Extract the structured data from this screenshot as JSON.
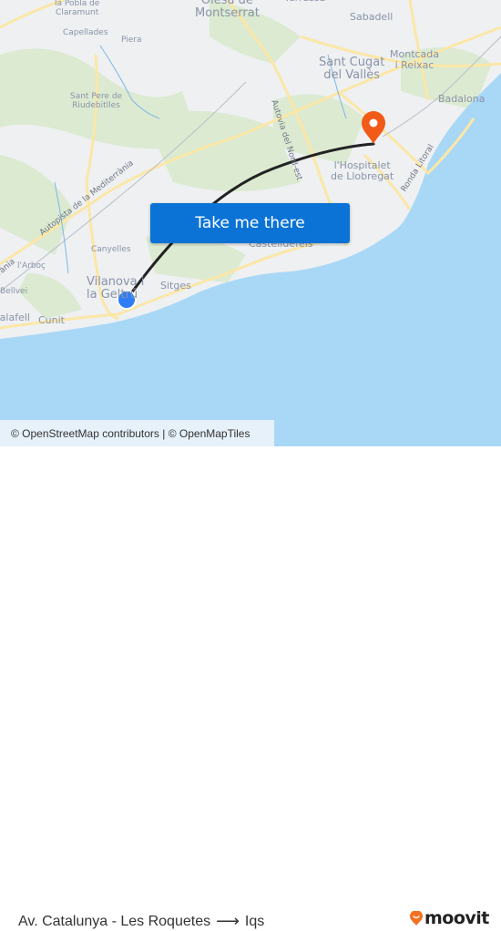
{
  "map": {
    "labels": [
      {
        "text": "la Pobla de\nClaramunt",
        "size": "sm"
      },
      {
        "text": "Capellades",
        "size": "sm"
      },
      {
        "text": "Piera",
        "size": "sm"
      },
      {
        "text": "Olesa de\nMontserrat",
        "size": "lg"
      },
      {
        "text": "Terrassa",
        "size": "md"
      },
      {
        "text": "Sabadell",
        "size": "md"
      },
      {
        "text": "Sant Cugat\ndel Vallès",
        "size": "lg"
      },
      {
        "text": "Montcada\ni Reixac",
        "size": "md"
      },
      {
        "text": "Badalona",
        "size": "md"
      },
      {
        "text": "Sant Pere de\nRiudebitlles",
        "size": "sm"
      },
      {
        "text": "l'Hospitalet\nde Llobregat",
        "size": "md"
      },
      {
        "text": "Canyelles",
        "size": "sm"
      },
      {
        "text": "l'Arboç",
        "size": "sm"
      },
      {
        "text": "Vilanova i\nla Geltrú",
        "size": "lg"
      },
      {
        "text": "Sitges",
        "size": "md"
      },
      {
        "text": "Castelldefels",
        "size": "md"
      },
      {
        "text": "Bellvei",
        "size": "sm"
      },
      {
        "text": "Calafell",
        "size": "md"
      },
      {
        "text": "Cunit",
        "size": "md"
      }
    ],
    "road_labels": [
      "Autovia del Nord-est",
      "Autopista de la Mediterrània",
      "Ronda Litoral",
      "rània"
    ],
    "origin_marker": "origin-dot-icon",
    "destination_marker": "destination-pin-icon",
    "colors": {
      "route": "#222222",
      "origin": "#2f7df6",
      "destination": "#f25a17",
      "sea": "#a9d8f6",
      "land": "#eef0f2",
      "forest": "#d8e9cc",
      "road": "#fbe7a6"
    }
  },
  "cta": {
    "label": "Take me there",
    "color": "#0b73d6"
  },
  "attribution": {
    "text": "© OpenStreetMap contributors | © OpenMapTiles"
  },
  "footer": {
    "origin": "Av. Catalunya - Les Roquetes",
    "arrow_icon": "arrow-right-icon",
    "destination": "Iqs",
    "logo_text": "moovit",
    "logo_color": "#f37021"
  }
}
